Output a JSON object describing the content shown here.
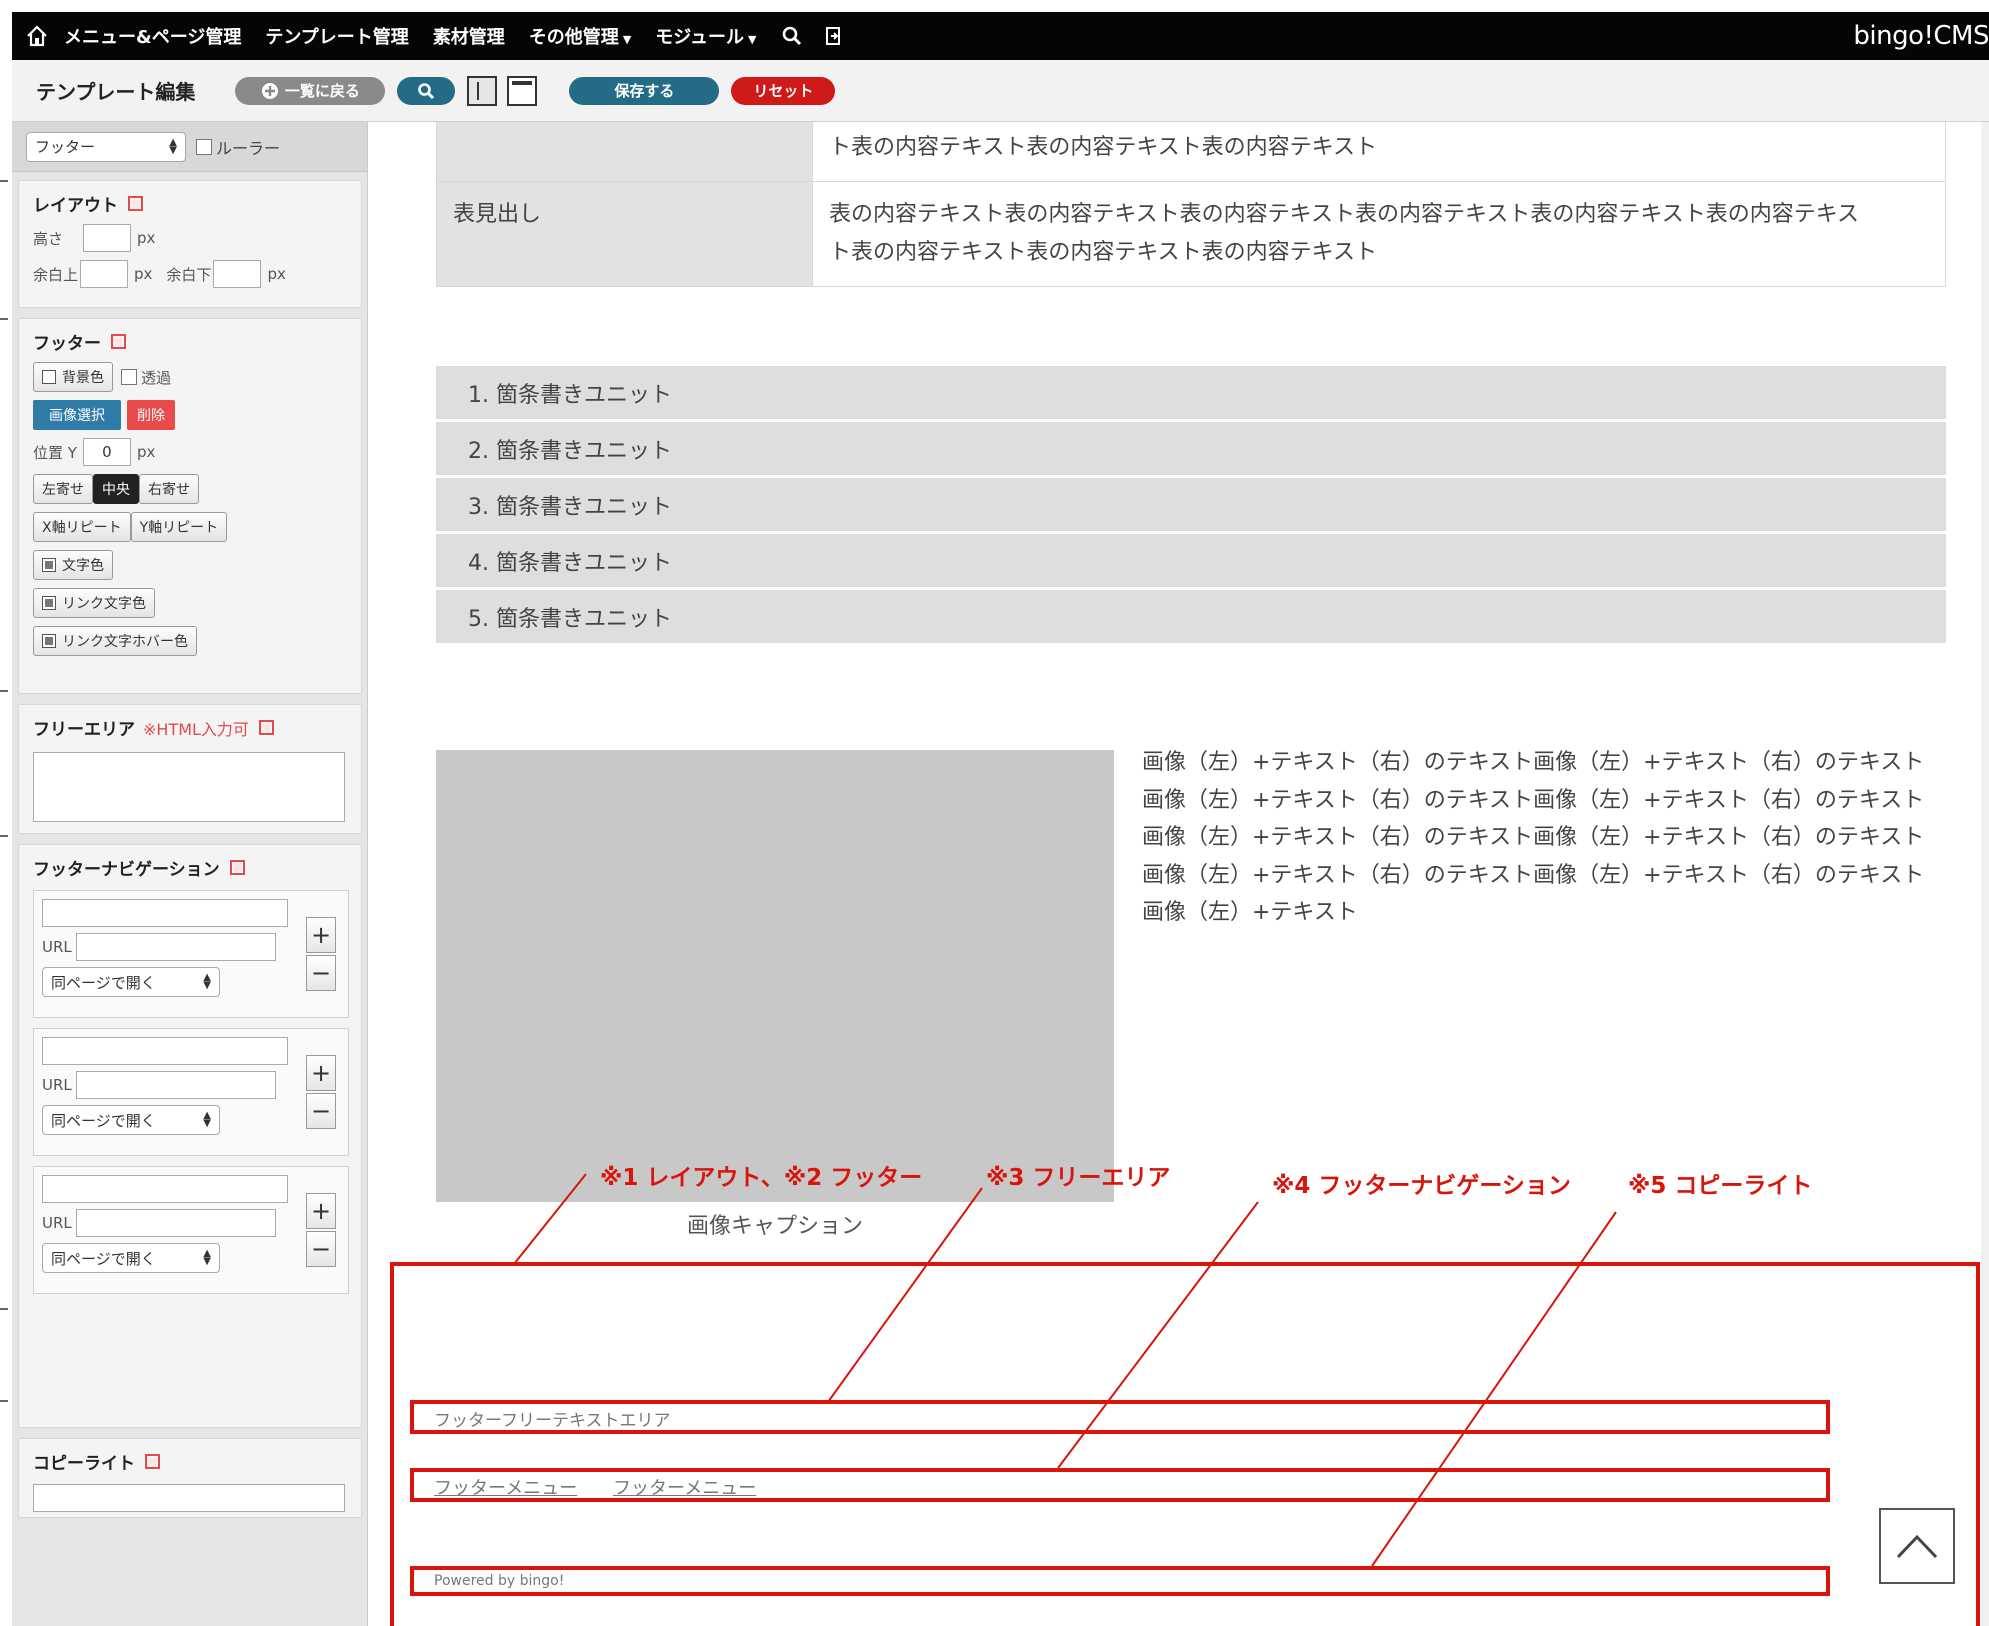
{
  "topbar": {
    "menu_page": "メニュー&ページ管理",
    "template": "テンプレート管理",
    "materials": "素材管理",
    "other": "その他管理",
    "module": "モジュール",
    "brand": "bingo!CMS"
  },
  "toolbar": {
    "title": "テンプレート編集",
    "back_label": "一覧に戻る",
    "save_label": "保存する",
    "reset_label": "リセット"
  },
  "sidebar": {
    "section_select": "フッター",
    "ruler_label": "ルーラー",
    "layout": {
      "heading": "レイアウト",
      "height_label": "高さ",
      "px": "px",
      "margin_top_label": "余白上",
      "margin_bottom_label": "余白下"
    },
    "footer": {
      "heading": "フッター",
      "bg_color_label": "背景色",
      "transparent_label": "透過",
      "select_image_label": "画像選択",
      "delete_label": "削除",
      "position_y_label": "位置 Y",
      "position_y_value": "0",
      "align_left": "左寄せ",
      "align_center": "中央",
      "align_right": "右寄せ",
      "repeat_x": "X軸リピート",
      "repeat_y": "Y軸リピート",
      "text_color": "文字色",
      "link_color": "リンク文字色",
      "link_hover_color": "リンク文字ホバー色"
    },
    "free_area": {
      "heading": "フリーエリア",
      "note": "※HTML入力可"
    },
    "footer_nav": {
      "heading": "フッターナビゲーション",
      "url_label": "URL",
      "target_option": "同ページで開く",
      "entries": [
        {},
        {},
        {}
      ]
    },
    "copyright": {
      "heading": "コピーライト"
    }
  },
  "main": {
    "table": {
      "row1_cell": "ト表の内容テキスト表の内容テキスト表の内容テキスト",
      "row2_header": "表見出し",
      "row2_cell_line1": "表の内容テキスト表の内容テキスト表の内容テキスト表の内容テキスト表の内容テキスト表の内容テキス",
      "row2_cell_line2": "ト表の内容テキスト表の内容テキスト表の内容テキスト"
    },
    "list_items": [
      "1. 箇条書きユニット",
      "2. 箇条書きユニット",
      "3. 箇条書きユニット",
      "4. 箇条書きユニット",
      "5. 箇条書きユニット"
    ],
    "image_caption": "画像キャプション",
    "image_text": "画像（左）+テキスト（右）のテキスト画像（左）+テキスト（右）のテキスト画像（左）+テキスト（右）のテキスト画像（左）+テキスト（右）のテキスト画像（左）+テキスト（右）のテキスト画像（左）+テキスト（右）のテキスト画像（左）+テキスト（右）のテキスト画像（左）+テキスト（右）のテキスト画像（左）+テキスト",
    "annotations": {
      "a1": "※1 レイアウト、※2 フッター",
      "a3": "※3 フリーエリア",
      "a4": "※4 フッターナビゲーション",
      "a5": "※5 コピーライト"
    },
    "footer": {
      "free_text": "フッターフリーテキストエリア",
      "menu_links": [
        "フッターメニュー",
        "フッターメニュー"
      ],
      "copyright": "Powered by bingo!"
    }
  },
  "colors": {
    "accent_teal": "#246b85",
    "danger_red": "#cf1a1a",
    "annotation_red": "#d9140a"
  }
}
